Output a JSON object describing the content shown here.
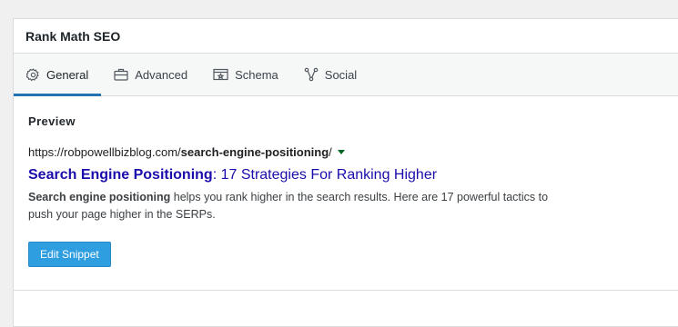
{
  "panel": {
    "title": "Rank Math SEO"
  },
  "tabs": [
    {
      "label": "General",
      "icon": "gear-icon",
      "active": true
    },
    {
      "label": "Advanced",
      "icon": "briefcase-icon",
      "active": false
    },
    {
      "label": "Schema",
      "icon": "schema-icon",
      "active": false
    },
    {
      "label": "Social",
      "icon": "social-share-icon",
      "active": false
    }
  ],
  "preview": {
    "heading": "Preview",
    "url_base": "https://robpowellbizblog.com/",
    "url_slug": "search-engine-positioning",
    "url_end": "/",
    "title_keyword": "Search Engine Positioning",
    "title_rest": ": 17 Strategies For Ranking Higher",
    "desc_keyword": "Search engine positioning",
    "desc_rest": " helps you rank higher in the search results. Here are 17 powerful tactics to push your page higher in the SERPs.",
    "edit_button": "Edit Snippet"
  },
  "colors": {
    "accent": "#2271b1",
    "button": "#2e9ee0",
    "link": "#1a0dab",
    "url_caret": "#006621"
  }
}
